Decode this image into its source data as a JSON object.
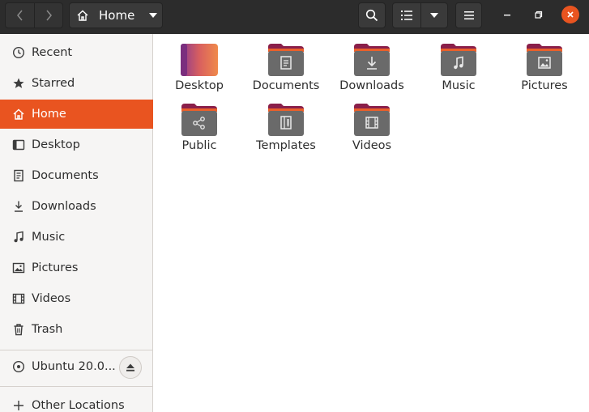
{
  "header": {
    "location_label": "Home",
    "icons": {
      "back": "chevron-left-icon",
      "forward": "chevron-right-icon",
      "home": "home-icon",
      "location_dropdown": "caret-down-icon",
      "search": "search-icon",
      "view_list": "list-view-icon",
      "view_options": "caret-down-icon",
      "menu": "hamburger-menu-icon",
      "minimize": "minimize-icon",
      "maximize": "maximize-icon",
      "close": "close-icon"
    },
    "colors": {
      "bar": "#2c2c2c",
      "close_button": "#e95420"
    }
  },
  "sidebar": {
    "items": [
      {
        "label": "Recent",
        "icon": "clock-icon"
      },
      {
        "label": "Starred",
        "icon": "star-icon"
      },
      {
        "label": "Home",
        "icon": "home-icon",
        "active": true
      },
      {
        "label": "Desktop",
        "icon": "desktop-icon"
      },
      {
        "label": "Documents",
        "icon": "document-icon"
      },
      {
        "label": "Downloads",
        "icon": "download-icon"
      },
      {
        "label": "Music",
        "icon": "music-icon"
      },
      {
        "label": "Pictures",
        "icon": "picture-icon"
      },
      {
        "label": "Videos",
        "icon": "video-icon"
      },
      {
        "label": "Trash",
        "icon": "trash-icon"
      }
    ],
    "devices": [
      {
        "label": "Ubuntu 20.0...",
        "icon": "disc-icon",
        "action_icon": "eject-icon"
      }
    ],
    "other": {
      "label": "Other Locations",
      "icon": "plus-icon"
    },
    "colors": {
      "active": "#e95420",
      "background": "#f6f5f4"
    }
  },
  "files": [
    {
      "name": "Desktop",
      "icon": "desktop-folder-icon"
    },
    {
      "name": "Documents",
      "icon": "documents-folder-icon"
    },
    {
      "name": "Downloads",
      "icon": "downloads-folder-icon"
    },
    {
      "name": "Music",
      "icon": "music-folder-icon"
    },
    {
      "name": "Pictures",
      "icon": "pictures-folder-icon"
    },
    {
      "name": "Public",
      "icon": "public-folder-icon"
    },
    {
      "name": "Templates",
      "icon": "templates-folder-icon"
    },
    {
      "name": "Videos",
      "icon": "videos-folder-icon"
    }
  ]
}
